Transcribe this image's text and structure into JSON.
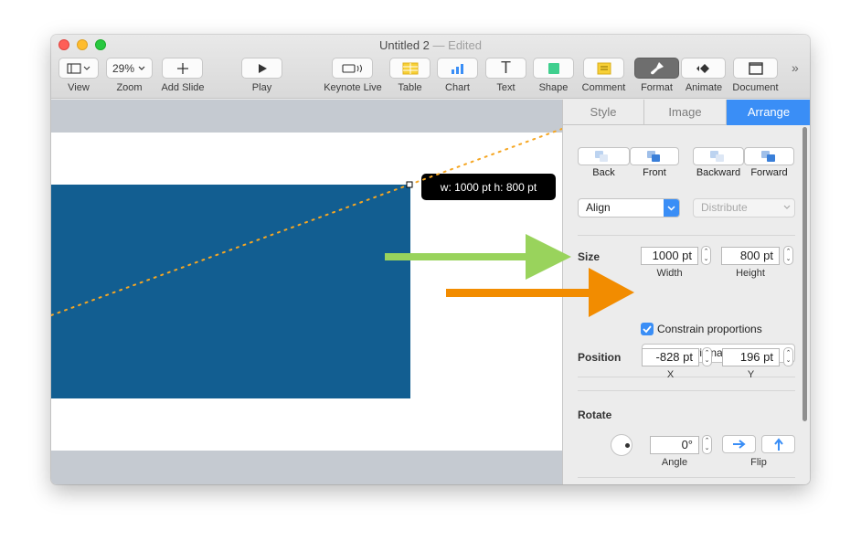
{
  "window": {
    "title": "Untitled 2",
    "title_suffix": "— Edited"
  },
  "toolbar": {
    "zoom_value": "29%",
    "items": [
      {
        "label": "View"
      },
      {
        "label": "Zoom"
      },
      {
        "label": "Add Slide"
      },
      {
        "label": "Play"
      },
      {
        "label": "Keynote Live"
      },
      {
        "label": "Table"
      },
      {
        "label": "Chart"
      },
      {
        "label": "Text"
      },
      {
        "label": "Shape"
      },
      {
        "label": "Comment"
      },
      {
        "label": "Format"
      },
      {
        "label": "Animate"
      },
      {
        "label": "Document"
      }
    ],
    "overflow": "»",
    "icons": {
      "text": "T",
      "play": "▶",
      "add": "+",
      "chevron": "⌄"
    }
  },
  "canvas": {
    "tooltip": "w: 1000 pt  h: 800 pt",
    "shape_color": "#125e91",
    "guide_color": "#f5a623"
  },
  "inspector": {
    "tabs": [
      {
        "label": "Style"
      },
      {
        "label": "Image"
      },
      {
        "label": "Arrange"
      }
    ],
    "arrange_buttons": [
      {
        "label": "Back"
      },
      {
        "label": "Front"
      },
      {
        "label": "Backward"
      },
      {
        "label": "Forward"
      }
    ],
    "align": {
      "value": "Align"
    },
    "distribute": {
      "value": "Distribute"
    },
    "size": {
      "label": "Size",
      "width": "1000 pt",
      "width_label": "Width",
      "height": "800 pt",
      "height_label": "Height",
      "constrain_label": "Constrain proportions",
      "constrain_checked": true,
      "original_size_label": "Original Size"
    },
    "position": {
      "label": "Position",
      "x": "-828 pt",
      "x_label": "X",
      "y": "196 pt",
      "y_label": "Y"
    },
    "rotate": {
      "label": "Rotate",
      "angle": "0°",
      "angle_label": "Angle",
      "flip_label": "Flip"
    }
  },
  "annotations": {
    "green_arrow_color": "#99d35c",
    "orange_arrow_color": "#f28c00"
  },
  "colors": {
    "accent": "#3a8ef6",
    "close": "#fe5f57",
    "minimize": "#febc2e",
    "zoom": "#28c840"
  }
}
